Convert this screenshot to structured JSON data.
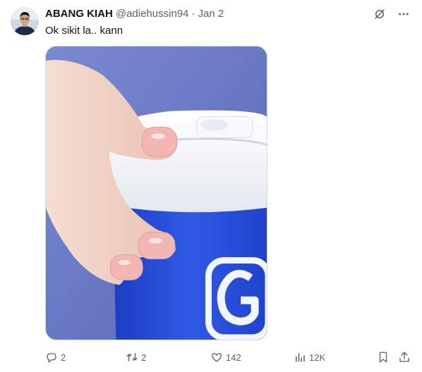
{
  "tweet": {
    "author_name": "ABANG KIAH",
    "handle": "@adiehussin94",
    "separator": "·",
    "date": "Jan 2",
    "text": "Ok sikit la.. kann"
  },
  "media": {
    "cup_logo_letter": "G",
    "colors": {
      "cup_blue": "#2a4fd8",
      "lid_white": "#f3f6fa",
      "nail_pink": "#f2b6b3",
      "skin": "#f1d2c7"
    }
  },
  "actions": {
    "replies": "2",
    "reposts": "2",
    "likes": "142",
    "views": "12K"
  },
  "icons": {
    "grok": "grok-icon",
    "more": "more-icon",
    "reply": "reply-icon",
    "repost": "repost-icon",
    "like": "heart-icon",
    "views": "views-icon",
    "bookmark": "bookmark-icon",
    "share": "share-icon"
  }
}
